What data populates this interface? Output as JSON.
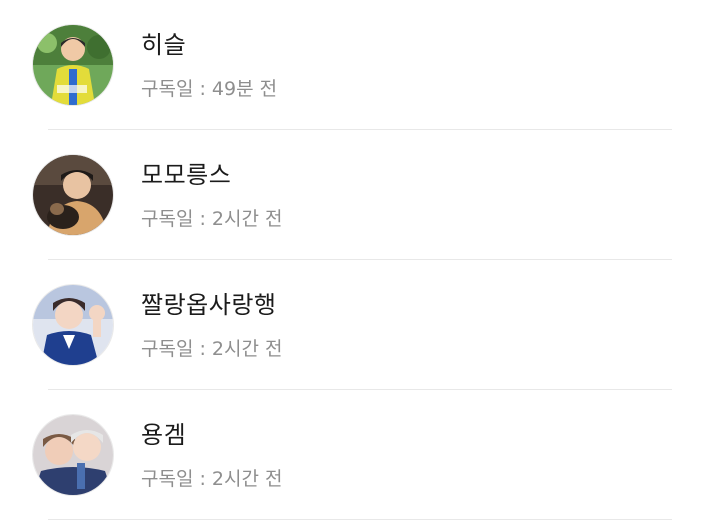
{
  "subscribers": [
    {
      "name": "히슬",
      "subscribed_label": "구독일 : 49분 전"
    },
    {
      "name": "모모릉스",
      "subscribed_label": "구독일 : 2시간 전"
    },
    {
      "name": "짤랑옵사랑행",
      "subscribed_label": "구독일 : 2시간 전"
    },
    {
      "name": "용겜",
      "subscribed_label": "구독일 : 2시간 전"
    }
  ]
}
